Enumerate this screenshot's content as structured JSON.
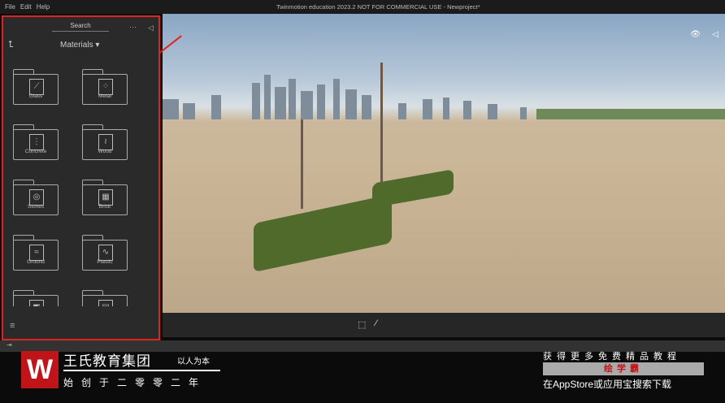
{
  "menu": [
    "File",
    "Edit",
    "Help"
  ],
  "window_title": "Twinmotion education 2023.2 NOT FOR COMMERCIAL USE - Newproject*",
  "sidebar": {
    "search": "Search",
    "category": "Materials ▾",
    "more": "···",
    "collapse": "◁",
    "up": "⮤",
    "tiles": [
      {
        "label": "Glass",
        "glyph": "⟋"
      },
      {
        "label": "Metal",
        "glyph": "⁘"
      },
      {
        "label": "Concrete",
        "glyph": "⋮"
      },
      {
        "label": "Wood",
        "glyph": "≀"
      },
      {
        "label": "Stones",
        "glyph": "◎"
      },
      {
        "label": "Brick",
        "glyph": "▦"
      },
      {
        "label": "Ground",
        "glyph": "≈"
      },
      {
        "label": "Plastic",
        "glyph": "∿"
      },
      {
        "label": "",
        "glyph": "◩"
      },
      {
        "label": "",
        "glyph": "▤"
      }
    ],
    "menu_icon": "≡"
  },
  "viewport": {
    "eye": "👁",
    "collapse": "◁"
  },
  "toolbar": {
    "frame": "⬚",
    "picker": "⁄"
  },
  "strip": {
    "exit": "⇥"
  },
  "banner": {
    "logo": "W",
    "org": "王氏教育集团",
    "motto": "以人为本",
    "since": "始创于二零零二年",
    "promo1": "获得更多免费精品教程",
    "promo2": "绘学霸",
    "promo3": "在AppStore或应用宝搜索下载"
  },
  "colors": {
    "highlight": "#e0231f",
    "brand": "#c0141b"
  }
}
